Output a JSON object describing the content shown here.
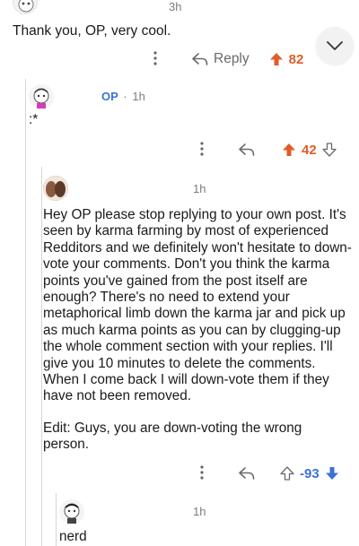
{
  "top_comment": {
    "time": "3h",
    "text": "Thank you, OP, very cool.",
    "reply_label": "Reply",
    "score": "82"
  },
  "op_comment": {
    "author": "OP",
    "separator": "·",
    "time": "1h",
    "text": ":*",
    "score": "42"
  },
  "long_comment": {
    "time": "1h",
    "text": "Hey OP please stop replying to your own post. It's seen by karma farming by most of experienced Redditors and we definitely won't hesitate to down-vote your comments. Don't you think the karma points you've gained from the post itself are enough? There's no need to extend your metaphorical limb down the karma jar and pick up as much karma points as you can by clugging-up the whole comment section with your replies. I'll give you 10 minutes to delete the comments. When I come back I will down-vote them if they have not been removed.",
    "edit": "Edit: Guys, you are down-voting the wrong person.",
    "score": "-93"
  },
  "nerd_comment": {
    "time": "1h",
    "text": "nerd"
  },
  "icons": {
    "more": "more-options-icon",
    "reply": "reply-arrow-icon",
    "upvote": "upvote-arrow-icon",
    "downvote": "downvote-arrow-icon",
    "collapse": "chevron-down-icon"
  },
  "colors": {
    "upvote": "#e25b28",
    "downvote": "#3d72d8",
    "link": "#3d72d8",
    "muted": "#7c7c7c"
  }
}
